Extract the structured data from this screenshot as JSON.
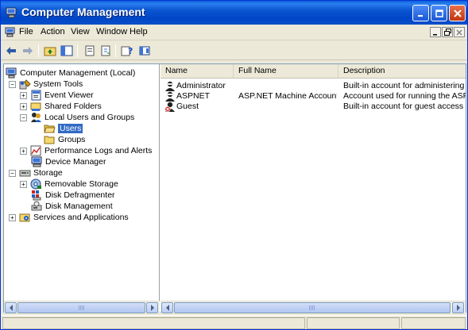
{
  "window": {
    "title": "Computer Management",
    "icon": "computer-management-icon"
  },
  "menubar": {
    "items": [
      "File",
      "Action",
      "View",
      "Window",
      "Help"
    ]
  },
  "toolbar": {
    "icons": [
      "back-arrow-icon",
      "forward-arrow-icon",
      "up-folder-icon",
      "show-hide-tree-icon",
      "properties-icon",
      "export-list-icon",
      "help-icon",
      "mmc-panel-icon"
    ]
  },
  "tree": {
    "items": [
      {
        "label": "Computer Management (Local)",
        "icon": "computer-management-icon",
        "expander": ""
      },
      {
        "label": "System Tools",
        "icon": "system-tools-icon",
        "expander": "−"
      },
      {
        "label": "Event Viewer",
        "icon": "event-viewer-icon",
        "expander": "+"
      },
      {
        "label": "Shared Folders",
        "icon": "shared-folders-icon",
        "expander": "+"
      },
      {
        "label": "Local Users and Groups",
        "icon": "users-groups-icon",
        "expander": "−"
      },
      {
        "label": "Users",
        "icon": "folder-open-icon",
        "expander": "",
        "selected": true
      },
      {
        "label": "Groups",
        "icon": "folder-icon",
        "expander": ""
      },
      {
        "label": "Performance Logs and Alerts",
        "icon": "performance-icon",
        "expander": "+"
      },
      {
        "label": "Device Manager",
        "icon": "device-manager-icon",
        "expander": ""
      },
      {
        "label": "Storage",
        "icon": "storage-icon",
        "expander": "−"
      },
      {
        "label": "Removable Storage",
        "icon": "removable-storage-icon",
        "expander": "+"
      },
      {
        "label": "Disk Defragmenter",
        "icon": "disk-defragmenter-icon",
        "expander": ""
      },
      {
        "label": "Disk Management",
        "icon": "disk-management-icon",
        "expander": ""
      },
      {
        "label": "Services and Applications",
        "icon": "services-applications-icon",
        "expander": "+"
      }
    ]
  },
  "list": {
    "columns": [
      "Name",
      "Full Name",
      "Description"
    ],
    "rows": [
      {
        "name": "Administrator",
        "full_name": "",
        "description": "Built-in account for administering th",
        "icon": "user-icon"
      },
      {
        "name": "ASPNET",
        "full_name": "ASP.NET Machine Account",
        "description": "Account used for running the ASP.I",
        "icon": "user-icon"
      },
      {
        "name": "Guest",
        "full_name": "",
        "description": "Built-in account for guest access to",
        "icon": "disabled-user-icon"
      }
    ]
  },
  "colors": {
    "titlebar": "#0a55d0",
    "selection": "#316ac5",
    "chrome": "#ece9d8"
  }
}
